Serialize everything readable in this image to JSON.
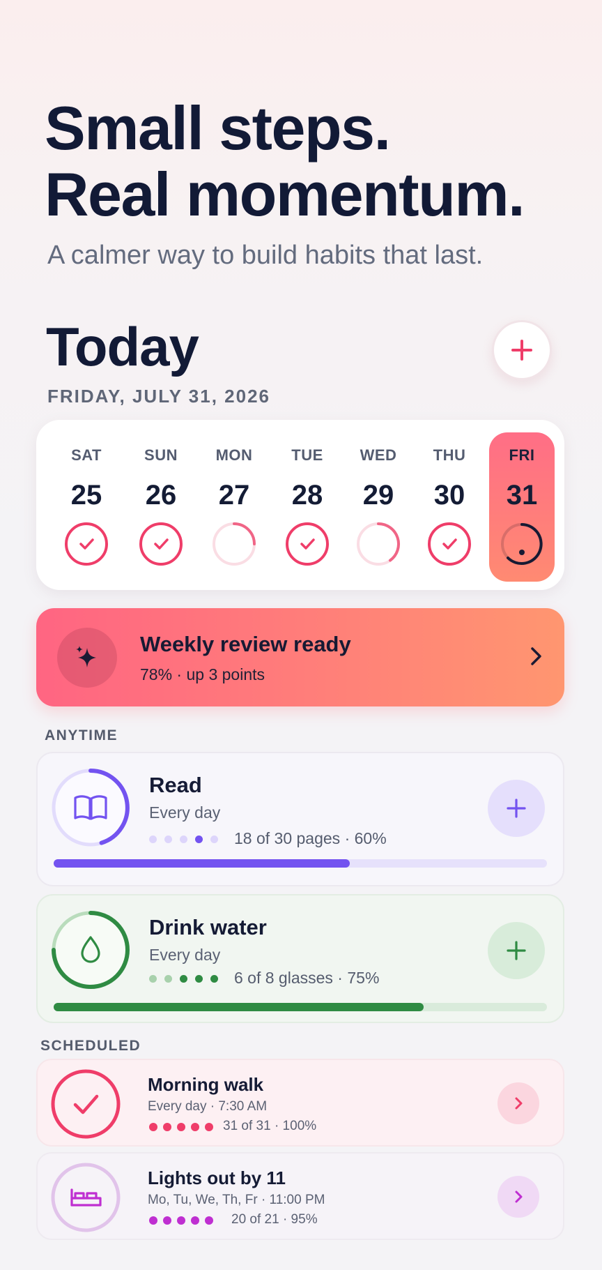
{
  "hero": {
    "title_line1": "Small steps.",
    "title_line2": "Real momentum.",
    "subtitle": "A calmer way to build habits that last."
  },
  "today": {
    "title": "Today",
    "date": "FRIDAY, JULY 31, 2026",
    "add_icon": "plus-icon"
  },
  "week": [
    {
      "day": "SAT",
      "num": "25",
      "status": "done"
    },
    {
      "day": "SUN",
      "num": "26",
      "status": "done"
    },
    {
      "day": "MON",
      "num": "27",
      "status": "partial",
      "progress": 0.3
    },
    {
      "day": "TUE",
      "num": "28",
      "status": "done"
    },
    {
      "day": "WED",
      "num": "29",
      "status": "partial",
      "progress": 0.45
    },
    {
      "day": "THU",
      "num": "30",
      "status": "done"
    },
    {
      "day": "FRI",
      "num": "31",
      "status": "today",
      "progress": 0.6
    }
  ],
  "review": {
    "title": "Weekly review ready",
    "subtitle": "78% · up 3 points",
    "icon": "sparkles-icon",
    "chevron": "chevron-right-icon"
  },
  "sections": {
    "anytime": "ANYTIME",
    "scheduled": "SCHEDULED"
  },
  "habits": [
    {
      "title": "Read",
      "frequency": "Every day",
      "progress_text": "18 of 30 pages · 60%",
      "progress": 0.6,
      "icon": "book-icon",
      "accent": "#7353f0"
    },
    {
      "title": "Drink water",
      "frequency": "Every day",
      "progress_text": "6 of 8 glasses · 75%",
      "progress": 0.75,
      "icon": "water-drop-icon",
      "accent": "#2f8b43"
    }
  ],
  "scheduled": [
    {
      "title": "Morning walk",
      "frequency": "Every day · 7:30 AM",
      "progress_text": "31 of 31 · 100%",
      "progress": 1.0,
      "icon": "check-icon",
      "accent": "#ef3d69"
    },
    {
      "title": "Lights out by 11",
      "frequency": "Mo, Tu, We, Th, Fr · 11:00 PM",
      "progress_text": "20 of 21 · 95%",
      "progress": 0.95,
      "icon": "bed-icon",
      "accent": "#bf2fd1"
    }
  ],
  "colors": {
    "ink": "#121a36",
    "pink": "#ef3d69",
    "read_accent": "#7353f0",
    "water_accent": "#2f8b43",
    "sleep_accent": "#bf2fd1"
  }
}
